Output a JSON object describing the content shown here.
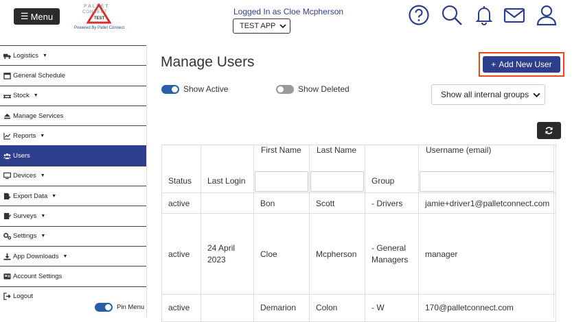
{
  "header": {
    "menu_label": "Menu",
    "logo_text_top": "PALLET",
    "logo_text_mid": "CONNECT",
    "logo_test": "TEST",
    "logo_powered": "Powered By Pallet Connect",
    "logged_in": "Logged In as Cloe Mcpherson",
    "app_selected": "TEST APP",
    "icons": [
      "help-icon",
      "search-icon",
      "bell-icon",
      "mail-icon",
      "user-icon"
    ]
  },
  "sidebar": {
    "items": [
      {
        "label": "Logistics",
        "icon": "truck-icon",
        "caret": true
      },
      {
        "label": "General Schedule",
        "icon": "calendar-icon",
        "caret": false
      },
      {
        "label": "Stock",
        "icon": "pallet-icon",
        "caret": true
      },
      {
        "label": "Manage Services",
        "icon": "eject-icon",
        "caret": false
      },
      {
        "label": "Reports",
        "icon": "chart-icon",
        "caret": true
      },
      {
        "label": "Users",
        "icon": "users-icon",
        "caret": false
      },
      {
        "label": "Devices",
        "icon": "monitor-icon",
        "caret": true
      },
      {
        "label": "Export Data",
        "icon": "export-icon",
        "caret": true
      },
      {
        "label": "Surveys",
        "icon": "survey-icon",
        "caret": true
      },
      {
        "label": "Settings",
        "icon": "gears-icon",
        "caret": true
      },
      {
        "label": "App Downloads",
        "icon": "download-icon",
        "caret": true
      },
      {
        "label": "Account Settings",
        "icon": "account-icon",
        "caret": false
      },
      {
        "label": "Logout",
        "icon": "logout-icon",
        "caret": false
      }
    ],
    "active_index": 5,
    "pin_label": "Pin Menu"
  },
  "main": {
    "title": "Manage Users",
    "add_user_label": "Add New User",
    "show_active_label": "Show Active",
    "show_deleted_label": "Show Deleted",
    "group_filter": "Show all internal groups"
  },
  "table": {
    "headers": {
      "status": "Status",
      "last_login": "Last Login",
      "first_name": "First Name",
      "last_name": "Last Name",
      "group": "Group",
      "username": "Username (email)"
    },
    "rows": [
      {
        "status": "active",
        "last_login": "",
        "first_name": "Bon",
        "last_name": "Scott",
        "group": "- Drivers",
        "username": "jamie+driver1@palletconnect.com"
      },
      {
        "status": "active",
        "last_login": "24 April 2023",
        "first_name": "Cloe",
        "last_name": "Mcpherson",
        "group": "- General Managers",
        "username": "manager"
      },
      {
        "status": "active",
        "last_login": "",
        "first_name": "Demarion",
        "last_name": "Colon",
        "group": "- W",
        "username": "170@palletconnect.com"
      }
    ]
  },
  "colors": {
    "primary": "#2c3e8c",
    "dark": "#2b2b2b",
    "highlight_border": "#e64a19"
  }
}
